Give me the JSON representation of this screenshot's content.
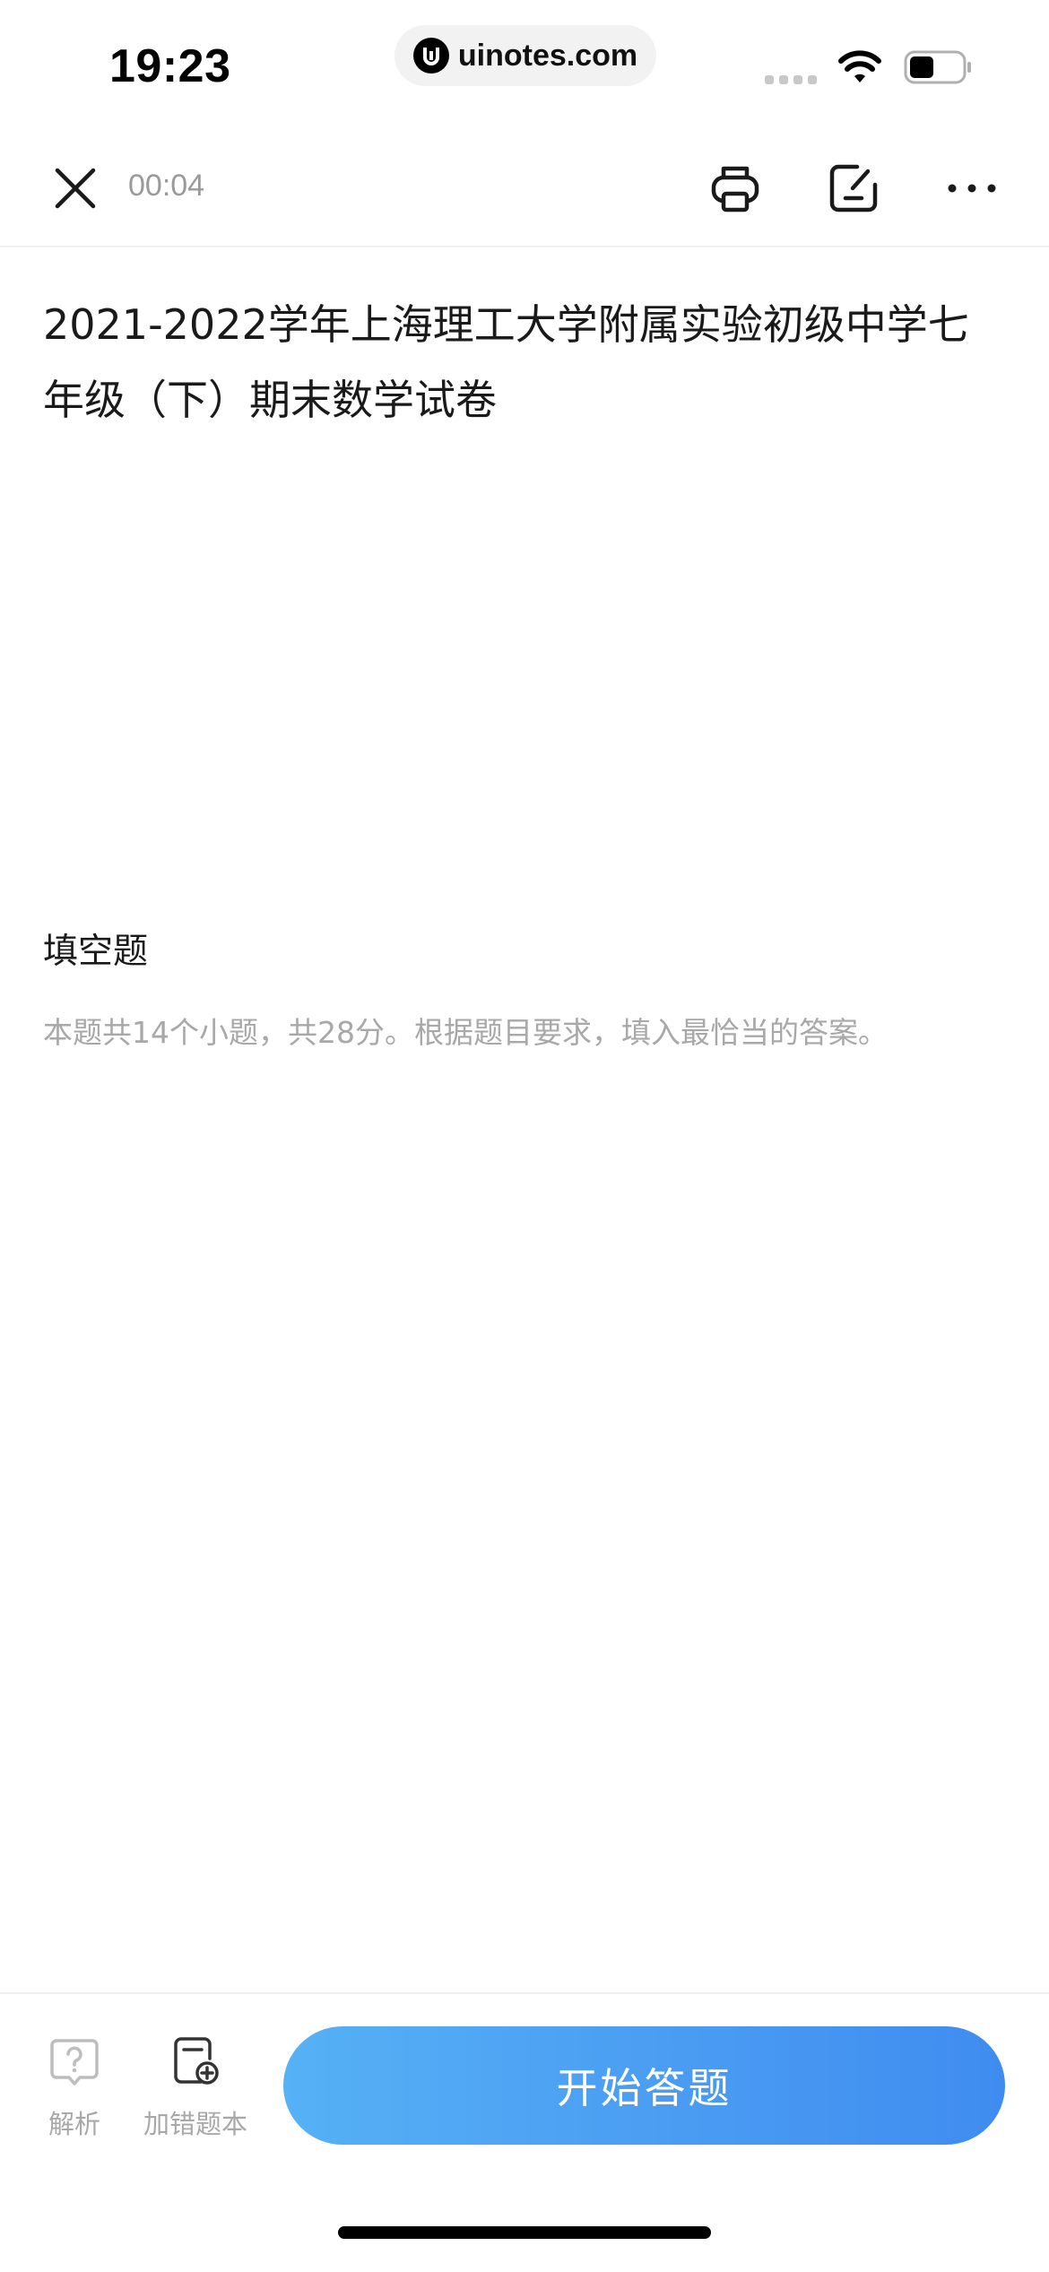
{
  "status_bar": {
    "time": "19:23",
    "url": "uinotes.com"
  },
  "toolbar": {
    "timer": "00:04"
  },
  "paper": {
    "title": "2021-2022学年上海理工大学附属实验初级中学七年级（下）期末数学试卷"
  },
  "section": {
    "title": "填空题",
    "description": "本题共14个小题，共28分。根据题目要求，填入最恰当的答案。"
  },
  "bottom_bar": {
    "analysis_label": "解析",
    "wrongbook_label": "加错题本",
    "start_label": "开始答题"
  },
  "icons": {
    "close": "close-icon",
    "print": "printer-icon",
    "edit": "edit-note-icon",
    "more": "more-dots-icon",
    "analysis": "question-bubble-icon",
    "wrongbook": "add-note-icon"
  },
  "colors": {
    "accent_start": "#56b1f5",
    "accent_end": "#3f8cf0",
    "muted_text": "#a8a8a8"
  }
}
